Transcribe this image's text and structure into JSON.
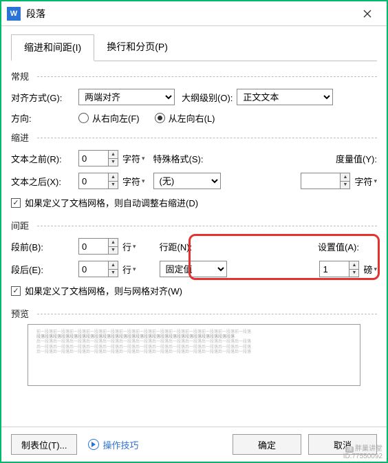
{
  "dialog": {
    "title": "段落"
  },
  "tabs": {
    "tab1": "缩进和间距(I)",
    "tab2": "换行和分页(P)"
  },
  "general": {
    "group": "常规",
    "align_label": "对齐方式(G):",
    "align_value": "两端对齐",
    "outline_label": "大纲级别(O):",
    "outline_value": "正文文本",
    "direction_label": "方向:",
    "rtl_label": "从右向左(F)",
    "ltr_label": "从左向右(L)"
  },
  "indent": {
    "group": "缩进",
    "before_label": "文本之前(R):",
    "before_value": "0",
    "before_unit": "字符",
    "after_label": "文本之后(X):",
    "after_value": "0",
    "after_unit": "字符",
    "special_label": "特殊格式(S):",
    "special_value": "(无)",
    "measure_label": "度量值(Y):",
    "measure_value": "",
    "measure_unit": "字符",
    "check_label": "如果定义了文档网格，则自动调整右缩进(D)"
  },
  "spacing": {
    "group": "间距",
    "before_label": "段前(B):",
    "before_value": "0",
    "before_unit": "行",
    "after_label": "段后(E):",
    "after_value": "0",
    "after_unit": "行",
    "line_label": "行距(N):",
    "line_value": "固定值",
    "set_label": "设置值(A):",
    "set_value": "1",
    "set_unit": "磅",
    "check_label": "如果定义了文档网格，则与网格对齐(W)"
  },
  "preview": {
    "label": "预览"
  },
  "footer": {
    "tabs_btn": "制表位(T)...",
    "tips": "操作技巧",
    "ok": "确定",
    "cancel": "取消"
  },
  "watermark": {
    "line1": "胖巢讲堂",
    "line2": "ID:77550092"
  }
}
